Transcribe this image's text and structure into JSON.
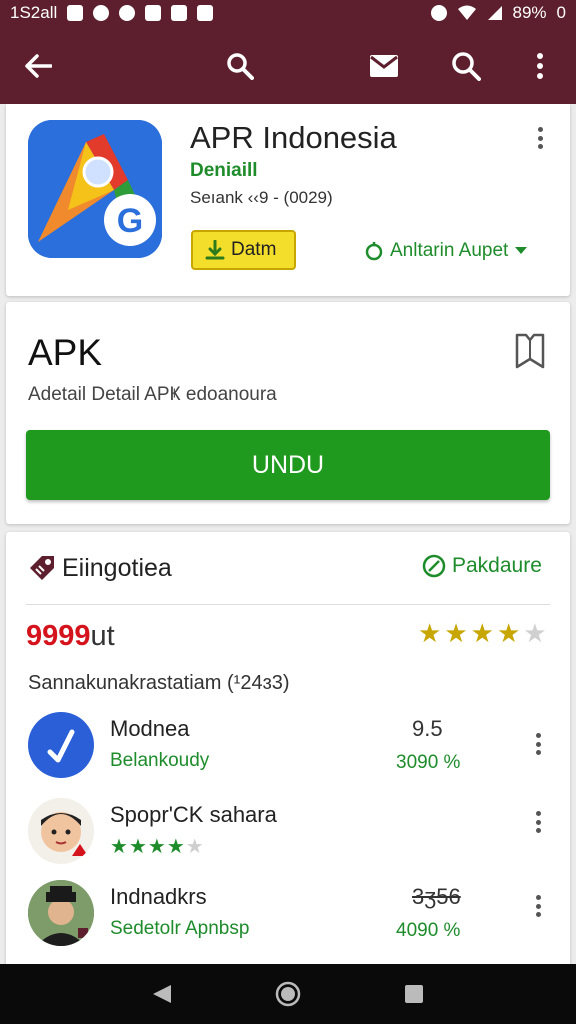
{
  "status_bar": {
    "time": "1S2all",
    "battery": "89%",
    "extra": "0"
  },
  "app_bar": {
    "back_icon": "arrow-left-icon",
    "search_icon": "search-icon",
    "mail_icon": "mail-icon",
    "search2_icon": "search-icon",
    "more_icon": "more-vert-icon"
  },
  "app_header": {
    "title": "APR Indonesia",
    "developer": "Deniaill",
    "rating_line": "Seıank ‹‹9 - (0029)",
    "datm_label": "Datm",
    "install_link": "Anltarin Aupet"
  },
  "apk_card": {
    "title": "APK",
    "description": "Adetail Detail APҜ edoanoura",
    "button": "UNDU"
  },
  "reviews": {
    "title": "Eiingotiea",
    "link": "Pakdaure",
    "score_value": "9999",
    "score_unit": "ut",
    "star_rating": 4,
    "summary": "Sannakunakrastatiam (¹24ɜ3)",
    "items": [
      {
        "name": "Modnea",
        "sub": "Belankoudy",
        "score": "9.5",
        "pct": "3090 %"
      },
      {
        "name": "Spopr'CK sahara",
        "stars": 4
      },
      {
        "name": "Indnadkrs",
        "sub": "Sedetolr Apnbsp",
        "score": "3ʒ56",
        "pct": "4090 %"
      }
    ]
  },
  "colors": {
    "primary": "#5d1f2e",
    "green": "#1f9a1f",
    "accent_yellow": "#f3de2c",
    "red": "#d5131c"
  }
}
